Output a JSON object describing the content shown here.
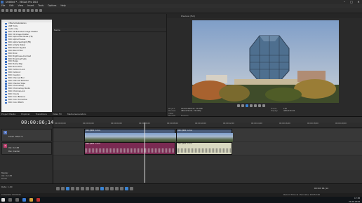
{
  "window": {
    "title": "Untitled * - VEGAS Pro 16.0",
    "min": "–",
    "max": "□",
    "close": "✕"
  },
  "menu": [
    "File",
    "Edit",
    "View",
    "Insert",
    "Tools",
    "Options",
    "Help"
  ],
  "explorer": {
    "header": "Name",
    "items": [
      "VEGAS Stabilization",
      "AVB Fonts",
      "Audio only",
      "BCC 3D Extruded Image Shatter",
      "BCC 3D Image Shatter",
      "BCC Alpha Pixel Noise (FB)",
      "BCC Alpha Process",
      "BCC Alpha Spotlight (FB)",
      "BCC Artist's Poster",
      "BCC Bleach Bypass",
      "BCC Blend Filter",
      "BCC Brick",
      "BCC Brightness-Contrast",
      "BCC Broadcast Safe",
      "BCC Bulge",
      "BCC Bump Map",
      "BCC Burnt Film",
      "BCC Cartoon Look",
      "BCC Cartoonr",
      "BCC Caustics",
      "BCC Channel Blur",
      "BCC Channel Switcher",
      "BCC Checker Wipe",
      "BCC Chroma Key",
      "BCC Chroma Key Studio",
      "BCC Chroma Look",
      "BCC Clouds",
      "BCC Color Balance",
      "BCC Color Correction",
      "BCC Color Match"
    ]
  },
  "explorer_tabs": [
    "Project Media",
    "Explorer",
    "Transitions",
    "Video FX",
    "Media Generators"
  ],
  "preview": {
    "header_label": "Preview (Full)",
    "project_label": "Project:",
    "project_value": "1920x1080x32, 25.000i",
    "preview_label": "Preview:",
    "preview_value": "480x270x32, 25.000p",
    "display_label": "Video Preview",
    "display_value": "Trimmer",
    "frame_label": "Frame:",
    "frame_value": "150",
    "display2_label": "Display:",
    "display2_value": "483x272x32"
  },
  "timeline": {
    "timecode": "00:00:06;14",
    "ruler": [
      "00:00:00;00",
      "00:00:02;00",
      "00:00:04;00",
      "00:00:06;00",
      "00:00:08;00",
      "00:00:10;00",
      "00:00:12;00",
      "00:00:14;00",
      "00:00:16;00",
      "00:00:18;00",
      "00:00:20;00"
    ],
    "tracks": [
      {
        "num": "1",
        "name": "Level: 100,0 %"
      },
      {
        "num": "2",
        "name": "Vol: 0,0 dB",
        "pan": "Pan: Center"
      }
    ],
    "clips": {
      "video_a": "000-Q001 1.mov",
      "video_b": "000-Q001 1.mov",
      "audio_a": "000-Q001 1.mov",
      "audio_b": "000-Q001 1.mov"
    }
  },
  "master": {
    "label": "Master",
    "vol": "Vol: 0,0 dB",
    "touch": "Touch"
  },
  "bottom": {
    "rate_label": "Rate: 1,00",
    "record_label": "Record Time (2 channels): 126:53:40",
    "tc": "00:00:06;14"
  },
  "status": {
    "left": "Complete: 00:00:01",
    "right": "Record Time (2 channels): 126:53:40"
  },
  "clock": {
    "time": "17:38",
    "date": "21.06.2019"
  }
}
